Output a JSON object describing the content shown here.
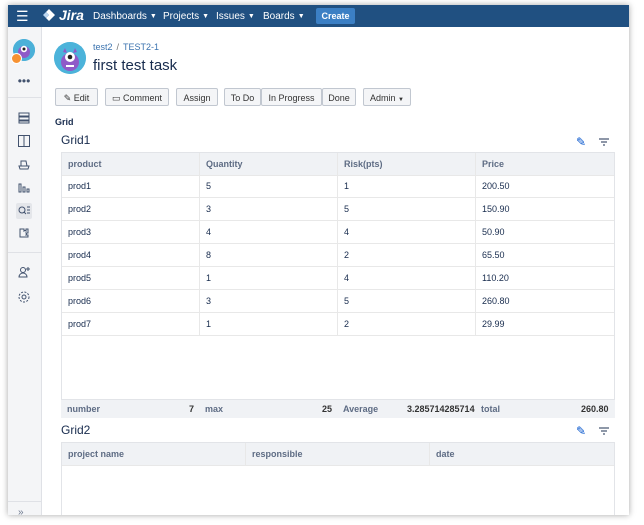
{
  "topnav": {
    "app_name": "Jira",
    "items": [
      {
        "label": "Dashboards"
      },
      {
        "label": "Projects"
      },
      {
        "label": "Issues"
      },
      {
        "label": "Boards"
      }
    ],
    "create_label": "Create"
  },
  "sidebar": {
    "more": "•••",
    "icons": [
      "backlog-icon",
      "board-icon",
      "releases-icon",
      "reports-icon",
      "issues-search-icon",
      "components-icon",
      "add-people-icon",
      "settings-icon"
    ],
    "collapse": "»"
  },
  "issue": {
    "breadcrumb_project": "test2",
    "breadcrumb_sep": "/",
    "breadcrumb_key": "TEST2-1",
    "title": "first test task"
  },
  "actions": {
    "edit": "Edit",
    "comment": "Comment",
    "assign": "Assign",
    "todo": "To Do",
    "in_progress": "In Progress",
    "done": "Done",
    "admin": "Admin"
  },
  "section_label": "Grid",
  "grid1": {
    "title": "Grid1",
    "columns": [
      "product",
      "Quantity",
      "Risk(pts)",
      "Price"
    ],
    "rows": [
      [
        "prod1",
        "5",
        "1",
        "200.50"
      ],
      [
        "prod2",
        "3",
        "5",
        "150.90"
      ],
      [
        "prod3",
        "4",
        "4",
        "50.90"
      ],
      [
        "prod4",
        "8",
        "2",
        "65.50"
      ],
      [
        "prod5",
        "1",
        "4",
        "110.20"
      ],
      [
        "prod6",
        "3",
        "5",
        "260.80"
      ],
      [
        "prod7",
        "1",
        "2",
        "29.99"
      ]
    ],
    "footer": [
      {
        "label": "number",
        "value": "7"
      },
      {
        "label": "max",
        "value": "25"
      },
      {
        "label": "Average",
        "value": "3.2857142857142"
      },
      {
        "label": "total",
        "value": "260.80"
      }
    ]
  },
  "grid2": {
    "title": "Grid2",
    "columns": [
      "project name",
      "responsible",
      "date"
    ]
  },
  "colors": {
    "topbar": "#205081",
    "create": "#3b7fc4",
    "link": "#3b73af"
  }
}
